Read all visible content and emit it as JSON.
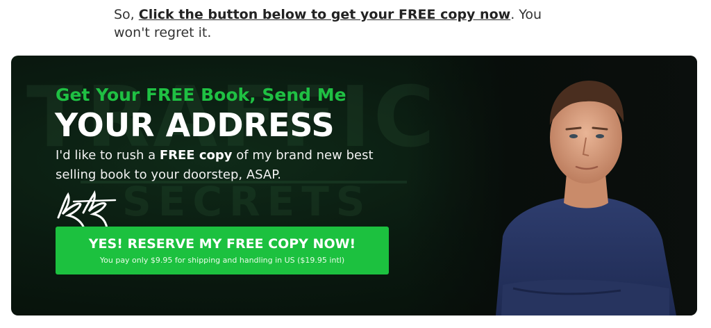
{
  "intro": {
    "prefix": "So, ",
    "link_text": "Click the button below to get your FREE copy now",
    "suffix": ". You won't regret it."
  },
  "banner": {
    "headline_small": "Get Your FREE Book, Send Me",
    "headline_big": "YOUR ADDRESS",
    "subtext_prefix": "I'd like to rush a ",
    "subtext_bold": "FREE copy",
    "subtext_suffix": " of my brand new best selling book to your doorstep, ASAP.",
    "background_word_1": "TRAFFIC",
    "background_word_2": "SECRETS",
    "cta": {
      "main_label": "YES! RESERVE MY FREE COPY NOW!",
      "sub_label": "You pay only $9.95 for shipping and handling in US ($19.95 intl)"
    }
  },
  "colors": {
    "accent_green": "#1cc13f",
    "headline_green": "#1fc043",
    "banner_bg": "#0a1a10"
  },
  "icons": {
    "signature": "handwritten-signature",
    "author_photo": "author-portrait"
  }
}
